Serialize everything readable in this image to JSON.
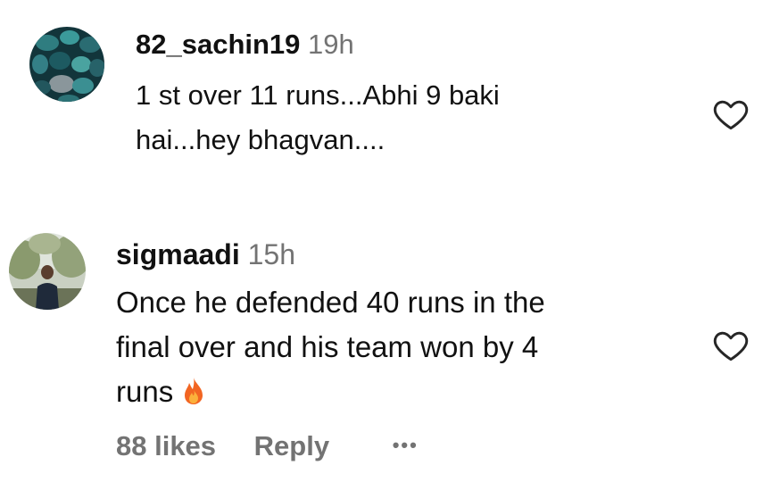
{
  "comments": [
    {
      "username": "82_sachin19",
      "time": "19h",
      "text_lines": [
        "1 st over 11 runs...Abhi 9 baki",
        "hai...hey bhagvan...."
      ],
      "avatar": "stones-avatar"
    },
    {
      "username": "sigmaadi",
      "time": "15h",
      "text_lines": [
        "Once he defended 40 runs in the",
        "final over and his team won by 4",
        "runs"
      ],
      "emoji": "fire-icon",
      "avatar": "person-outdoor-avatar",
      "likes": "88 likes",
      "reply": "Reply",
      "more": "•••"
    }
  ],
  "colors": {
    "text": "#111111",
    "muted": "#737373",
    "heart_stroke": "#262626"
  },
  "icons": {
    "like": "heart-outline-icon",
    "more": "more-options-icon"
  }
}
